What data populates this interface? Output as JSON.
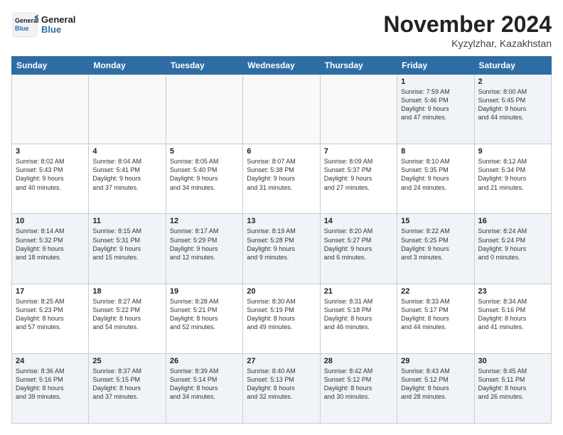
{
  "header": {
    "logo_general": "General",
    "logo_blue": "Blue",
    "month_title": "November 2024",
    "location": "Kyzylzhar, Kazakhstan"
  },
  "days_of_week": [
    "Sunday",
    "Monday",
    "Tuesday",
    "Wednesday",
    "Thursday",
    "Friday",
    "Saturday"
  ],
  "weeks": [
    [
      {
        "day": "",
        "info": ""
      },
      {
        "day": "",
        "info": ""
      },
      {
        "day": "",
        "info": ""
      },
      {
        "day": "",
        "info": ""
      },
      {
        "day": "",
        "info": ""
      },
      {
        "day": "1",
        "info": "Sunrise: 7:59 AM\nSunset: 5:46 PM\nDaylight: 9 hours\nand 47 minutes."
      },
      {
        "day": "2",
        "info": "Sunrise: 8:00 AM\nSunset: 5:45 PM\nDaylight: 9 hours\nand 44 minutes."
      }
    ],
    [
      {
        "day": "3",
        "info": "Sunrise: 8:02 AM\nSunset: 5:43 PM\nDaylight: 9 hours\nand 40 minutes."
      },
      {
        "day": "4",
        "info": "Sunrise: 8:04 AM\nSunset: 5:41 PM\nDaylight: 9 hours\nand 37 minutes."
      },
      {
        "day": "5",
        "info": "Sunrise: 8:05 AM\nSunset: 5:40 PM\nDaylight: 9 hours\nand 34 minutes."
      },
      {
        "day": "6",
        "info": "Sunrise: 8:07 AM\nSunset: 5:38 PM\nDaylight: 9 hours\nand 31 minutes."
      },
      {
        "day": "7",
        "info": "Sunrise: 8:09 AM\nSunset: 5:37 PM\nDaylight: 9 hours\nand 27 minutes."
      },
      {
        "day": "8",
        "info": "Sunrise: 8:10 AM\nSunset: 5:35 PM\nDaylight: 9 hours\nand 24 minutes."
      },
      {
        "day": "9",
        "info": "Sunrise: 8:12 AM\nSunset: 5:34 PM\nDaylight: 9 hours\nand 21 minutes."
      }
    ],
    [
      {
        "day": "10",
        "info": "Sunrise: 8:14 AM\nSunset: 5:32 PM\nDaylight: 9 hours\nand 18 minutes."
      },
      {
        "day": "11",
        "info": "Sunrise: 8:15 AM\nSunset: 5:31 PM\nDaylight: 9 hours\nand 15 minutes."
      },
      {
        "day": "12",
        "info": "Sunrise: 8:17 AM\nSunset: 5:29 PM\nDaylight: 9 hours\nand 12 minutes."
      },
      {
        "day": "13",
        "info": "Sunrise: 8:19 AM\nSunset: 5:28 PM\nDaylight: 9 hours\nand 9 minutes."
      },
      {
        "day": "14",
        "info": "Sunrise: 8:20 AM\nSunset: 5:27 PM\nDaylight: 9 hours\nand 6 minutes."
      },
      {
        "day": "15",
        "info": "Sunrise: 8:22 AM\nSunset: 5:25 PM\nDaylight: 9 hours\nand 3 minutes."
      },
      {
        "day": "16",
        "info": "Sunrise: 8:24 AM\nSunset: 5:24 PM\nDaylight: 9 hours\nand 0 minutes."
      }
    ],
    [
      {
        "day": "17",
        "info": "Sunrise: 8:25 AM\nSunset: 5:23 PM\nDaylight: 8 hours\nand 57 minutes."
      },
      {
        "day": "18",
        "info": "Sunrise: 8:27 AM\nSunset: 5:22 PM\nDaylight: 8 hours\nand 54 minutes."
      },
      {
        "day": "19",
        "info": "Sunrise: 8:28 AM\nSunset: 5:21 PM\nDaylight: 8 hours\nand 52 minutes."
      },
      {
        "day": "20",
        "info": "Sunrise: 8:30 AM\nSunset: 5:19 PM\nDaylight: 8 hours\nand 49 minutes."
      },
      {
        "day": "21",
        "info": "Sunrise: 8:31 AM\nSunset: 5:18 PM\nDaylight: 8 hours\nand 46 minutes."
      },
      {
        "day": "22",
        "info": "Sunrise: 8:33 AM\nSunset: 5:17 PM\nDaylight: 8 hours\nand 44 minutes."
      },
      {
        "day": "23",
        "info": "Sunrise: 8:34 AM\nSunset: 5:16 PM\nDaylight: 8 hours\nand 41 minutes."
      }
    ],
    [
      {
        "day": "24",
        "info": "Sunrise: 8:36 AM\nSunset: 5:16 PM\nDaylight: 8 hours\nand 39 minutes."
      },
      {
        "day": "25",
        "info": "Sunrise: 8:37 AM\nSunset: 5:15 PM\nDaylight: 8 hours\nand 37 minutes."
      },
      {
        "day": "26",
        "info": "Sunrise: 8:39 AM\nSunset: 5:14 PM\nDaylight: 8 hours\nand 34 minutes."
      },
      {
        "day": "27",
        "info": "Sunrise: 8:40 AM\nSunset: 5:13 PM\nDaylight: 8 hours\nand 32 minutes."
      },
      {
        "day": "28",
        "info": "Sunrise: 8:42 AM\nSunset: 5:12 PM\nDaylight: 8 hours\nand 30 minutes."
      },
      {
        "day": "29",
        "info": "Sunrise: 8:43 AM\nSunset: 5:12 PM\nDaylight: 8 hours\nand 28 minutes."
      },
      {
        "day": "30",
        "info": "Sunrise: 8:45 AM\nSunset: 5:11 PM\nDaylight: 8 hours\nand 26 minutes."
      }
    ]
  ]
}
